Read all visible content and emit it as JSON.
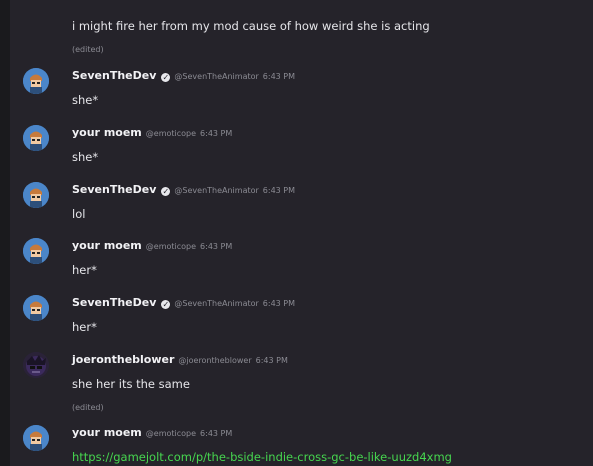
{
  "messages": [
    {
      "lines": [
        "i might fire her from my mod cause of how weird she is acting"
      ],
      "edited": "(edited)"
    },
    {
      "author": "SevenTheDev",
      "verified": true,
      "handle": "@SevenTheAnimator",
      "time": "6:43 PM",
      "text": "she*"
    },
    {
      "author": "your moem",
      "verified": false,
      "handle": "@emoticope",
      "time": "6:43 PM",
      "text": "she*"
    },
    {
      "author": "SevenTheDev",
      "verified": true,
      "handle": "@SevenTheAnimator",
      "time": "6:43 PM",
      "text": "lol"
    },
    {
      "author": "your moem",
      "verified": false,
      "handle": "@emoticope",
      "time": "6:43 PM",
      "text": "her*"
    },
    {
      "author": "SevenTheDev",
      "verified": true,
      "handle": "@SevenTheAnimator",
      "time": "6:43 PM",
      "text": "her*"
    },
    {
      "author": "joerontheblower",
      "verified": false,
      "handle": "@joerontheblower",
      "time": "6:43 PM",
      "text": "she her its the same",
      "edited": "(edited)"
    },
    {
      "author": "your moem",
      "verified": false,
      "handle": "@emoticope",
      "time": "6:43 PM",
      "link": "https://gamejolt.com/p/the-bside-indie-cross-gc-be-like-uuzd4xmg"
    }
  ],
  "colors": {
    "background": "#25232a",
    "link": "#46d64f",
    "text": "#e6e6ea",
    "muted": "#8b8b93"
  },
  "icons": {
    "verified": "verified-badge-icon"
  }
}
